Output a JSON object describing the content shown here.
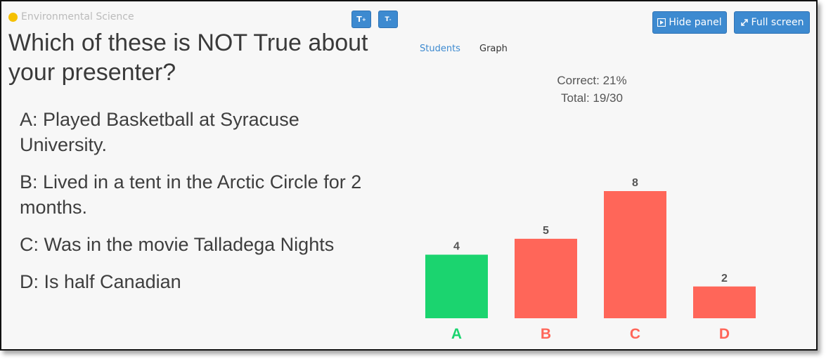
{
  "course_title": "Environmental Science",
  "text_controls": {
    "increase": "T",
    "increase_sup": "+",
    "decrease": "T",
    "decrease_sup": "-"
  },
  "question": "Which of these is NOT True about your presenter?",
  "answers": [
    "A: Played Basketball at Syracuse University.",
    "B: Lived in a tent in the Arctic Circle for 2 months.",
    "C: Was in the movie Talladega Nights",
    "D: Is half Canadian"
  ],
  "buttons": {
    "hide_panel": "Hide panel",
    "full_screen": "Full screen"
  },
  "tabs": {
    "students": "Students",
    "graph": "Graph"
  },
  "stats": {
    "correct": "Correct: 21%",
    "total": "Total: 19/30"
  },
  "colors": {
    "correct": "#1bd46f",
    "incorrect": "#ff6659",
    "accent": "#3d8ad0"
  },
  "chart_data": {
    "type": "bar",
    "categories": [
      "A",
      "B",
      "C",
      "D"
    ],
    "values": [
      4,
      5,
      8,
      2
    ],
    "correct": [
      true,
      false,
      false,
      false
    ],
    "title": "",
    "xlabel": "",
    "ylabel": ""
  }
}
